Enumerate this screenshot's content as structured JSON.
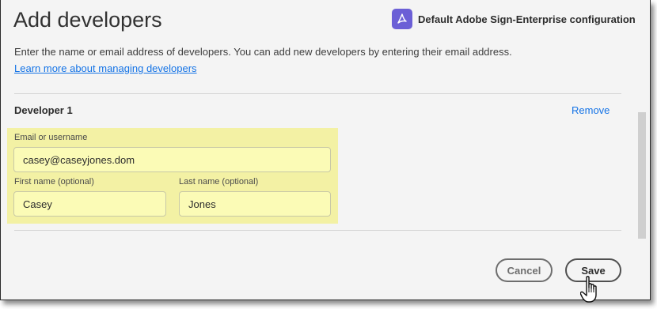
{
  "dialog": {
    "title": "Add developers",
    "config_label": "Default Adobe Sign-Enterprise configuration",
    "config_icon": "adobe-acrobat-sign-icon",
    "description": "Enter the name or email address of developers. You can add new developers by entering their email address.",
    "learn_more_link": "Learn more about managing developers"
  },
  "developer": {
    "heading": "Developer 1",
    "remove_label": "Remove",
    "email_label": "Email or username",
    "email_value": "casey@caseyjones.dom",
    "first_name_label": "First name (optional)",
    "first_name_value": "Casey",
    "last_name_label": "Last name (optional)",
    "last_name_value": "Jones"
  },
  "actions": {
    "cancel_label": "Cancel",
    "save_label": "Save"
  },
  "colors": {
    "link": "#1473e6",
    "highlight": "#f3f1a4",
    "brand_icon": "#6b5fd6"
  }
}
